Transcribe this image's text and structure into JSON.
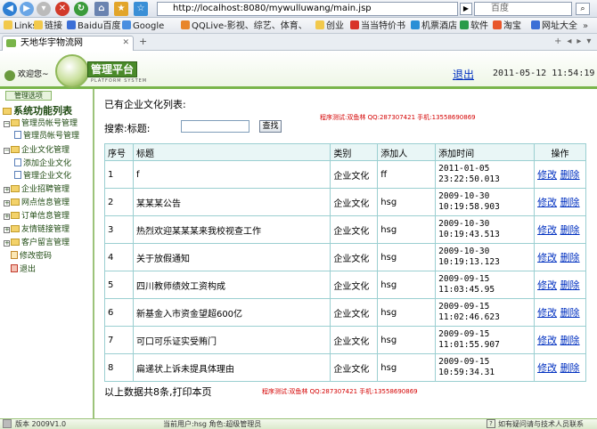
{
  "browser": {
    "url": "http://localhost:8080/mywulluwang/main.jsp",
    "search_placeholder": "百度",
    "bookmarks": [
      "Links",
      "链接",
      "Baidu百度",
      "Google",
      "QQLive-影视、综艺、体育、直播...",
      "创业",
      "当当特价书",
      "机票酒店",
      "软件",
      "淘宝",
      "网址大全"
    ],
    "tab_title": "天地华宇物流网"
  },
  "app": {
    "welcome": "欢迎您~",
    "logo_title": "管理平台",
    "logo_sub": "PLATFORM SYSTEM",
    "logout": "退出",
    "datetime": "2011-05-12 11:54:19 AM"
  },
  "sidebar": {
    "tab_label": "管理选项",
    "root": "系统功能列表",
    "items": [
      {
        "label": "管理员帐号管理",
        "kind": "folder",
        "expanded": true
      },
      {
        "label": "管理员帐号管理",
        "kind": "doc"
      },
      {
        "label": "企业文化管理",
        "kind": "folder",
        "expanded": true
      },
      {
        "label": "添加企业文化",
        "kind": "doc"
      },
      {
        "label": "管理企业文化",
        "kind": "doc"
      },
      {
        "label": "企业招聘管理",
        "kind": "folder",
        "expanded": false
      },
      {
        "label": "网点信息管理",
        "kind": "folder",
        "expanded": false
      },
      {
        "label": "订单信息管理",
        "kind": "folder",
        "expanded": false
      },
      {
        "label": "友情链接管理",
        "kind": "folder",
        "expanded": false
      },
      {
        "label": "客户留言管理",
        "kind": "folder",
        "expanded": false
      },
      {
        "label": "修改密码",
        "kind": "leaf"
      },
      {
        "label": "退出",
        "kind": "leaf"
      }
    ]
  },
  "main": {
    "heading": "已有企业文化列表:",
    "credit": "程序测试:双鱼林 QQ:287307421 手机:13558690869",
    "search_label": "搜索:标题:",
    "search_value": "",
    "search_button": "查找",
    "columns": [
      "序号",
      "标题",
      "类别",
      "添加人",
      "添加时间",
      "操作"
    ],
    "rows": [
      [
        "1",
        "f",
        "企业文化",
        "ff",
        "2011-01-05 23:22:50.013"
      ],
      [
        "2",
        "某某某公告",
        "企业文化",
        "hsg",
        "2009-10-30 10:19:58.903"
      ],
      [
        "3",
        "热烈欢迎某某某来我校视查工作",
        "企业文化",
        "hsg",
        "2009-10-30 10:19:43.513"
      ],
      [
        "4",
        "关于放假通知",
        "企业文化",
        "hsg",
        "2009-10-30 10:19:13.123"
      ],
      [
        "5",
        "四川教师绩效工资构成",
        "企业文化",
        "hsg",
        "2009-09-15 11:03:45.95"
      ],
      [
        "6",
        "新基金入市资金望超600亿",
        "企业文化",
        "hsg",
        "2009-09-15 11:02:46.623"
      ],
      [
        "7",
        "可口可乐证实受贿门",
        "企业文化",
        "hsg",
        "2009-09-15 11:01:55.907"
      ],
      [
        "8",
        "扁递状上诉未提具体理由",
        "企业文化",
        "hsg",
        "2009-09-15 10:59:34.31"
      ]
    ],
    "edit_label": "修改",
    "delete_label": "删除",
    "summary": "以上数据共8条,打印本页"
  },
  "footer": {
    "version": "版本 2009V1.0",
    "current_user": "当前用户:hsg  角色:超级管理员",
    "help": "如有疑问请与技术人员联系"
  },
  "colors": {
    "accent": "#79b54a",
    "grid": "#9bcfd1",
    "credit": "#d40000"
  }
}
